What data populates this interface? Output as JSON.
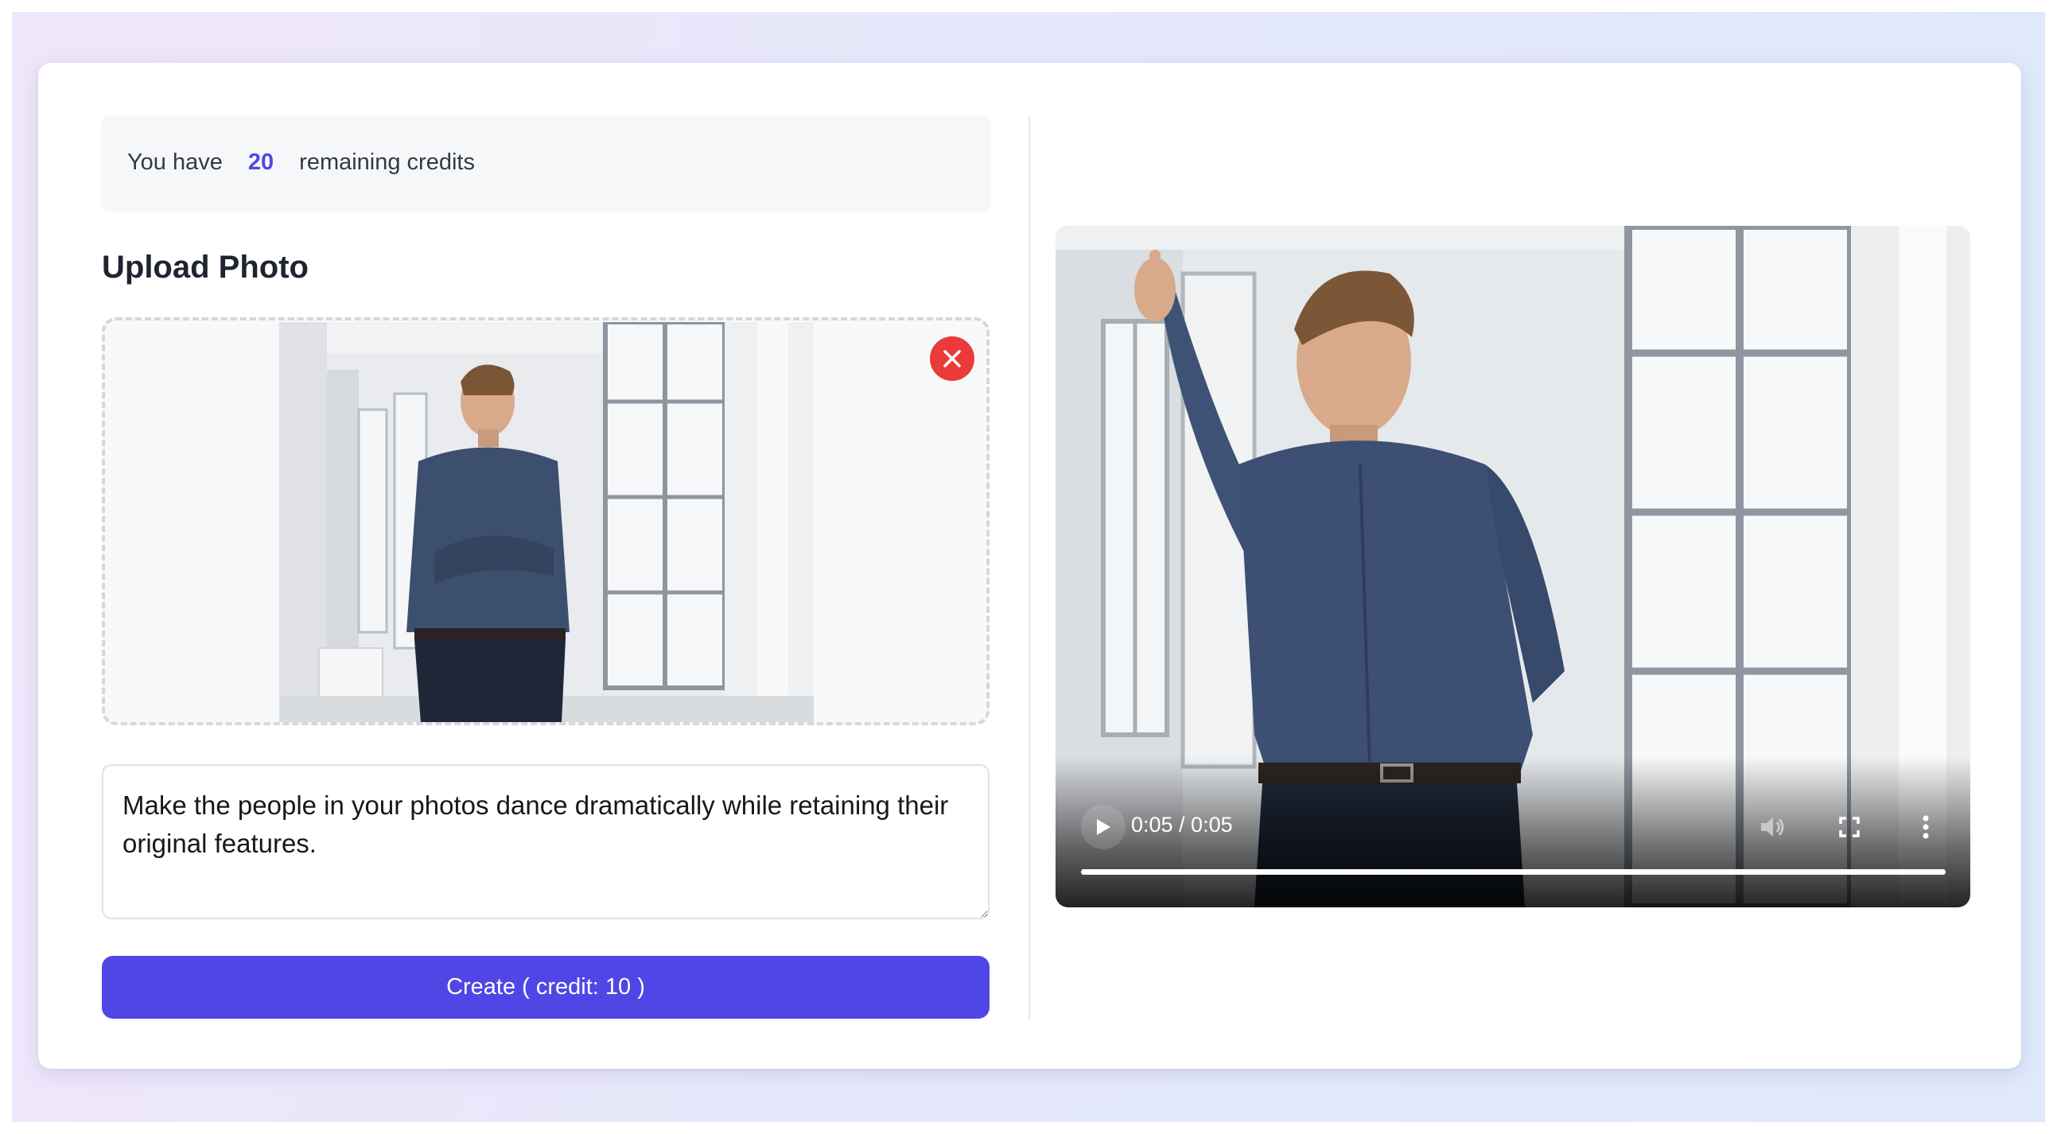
{
  "credits": {
    "prefix": "You have",
    "count": "20",
    "suffix": "remaining credits",
    "count_color": "#4f46e5"
  },
  "upload": {
    "title": "Upload Photo",
    "preview_image": "man-in-blue-shirt-arms-crossed-by-window",
    "remove_icon": "close-icon"
  },
  "prompt": {
    "value": "Make the people in your photos dance dramatically while retaining their original features."
  },
  "create_button": {
    "label": "Create ( credit: 10 )",
    "color": "#4f46e5"
  },
  "video": {
    "frame_image": "man-dancing-pointing-up-by-window",
    "time": "0:05 / 0:05",
    "progress": 1.0,
    "icons": [
      "play-icon",
      "volume-icon",
      "fullscreen-icon",
      "more-options-icon"
    ]
  }
}
